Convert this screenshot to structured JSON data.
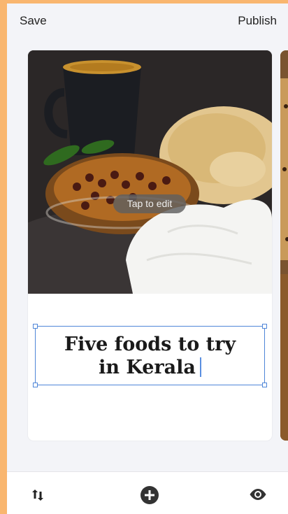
{
  "header": {
    "save_label": "Save",
    "publish_label": "Publish"
  },
  "card": {
    "tap_hint": "Tap to edit",
    "title_line1": "Five foods to try",
    "title_line2": "in Kerala"
  },
  "toolbar": {
    "icons": [
      "reorder-icon",
      "add-circle-icon",
      "preview-eye-icon"
    ]
  },
  "colors": {
    "frame": "#f9b66f",
    "background": "#f3f4f8",
    "selection": "#4f86d8",
    "icon": "#333333"
  }
}
